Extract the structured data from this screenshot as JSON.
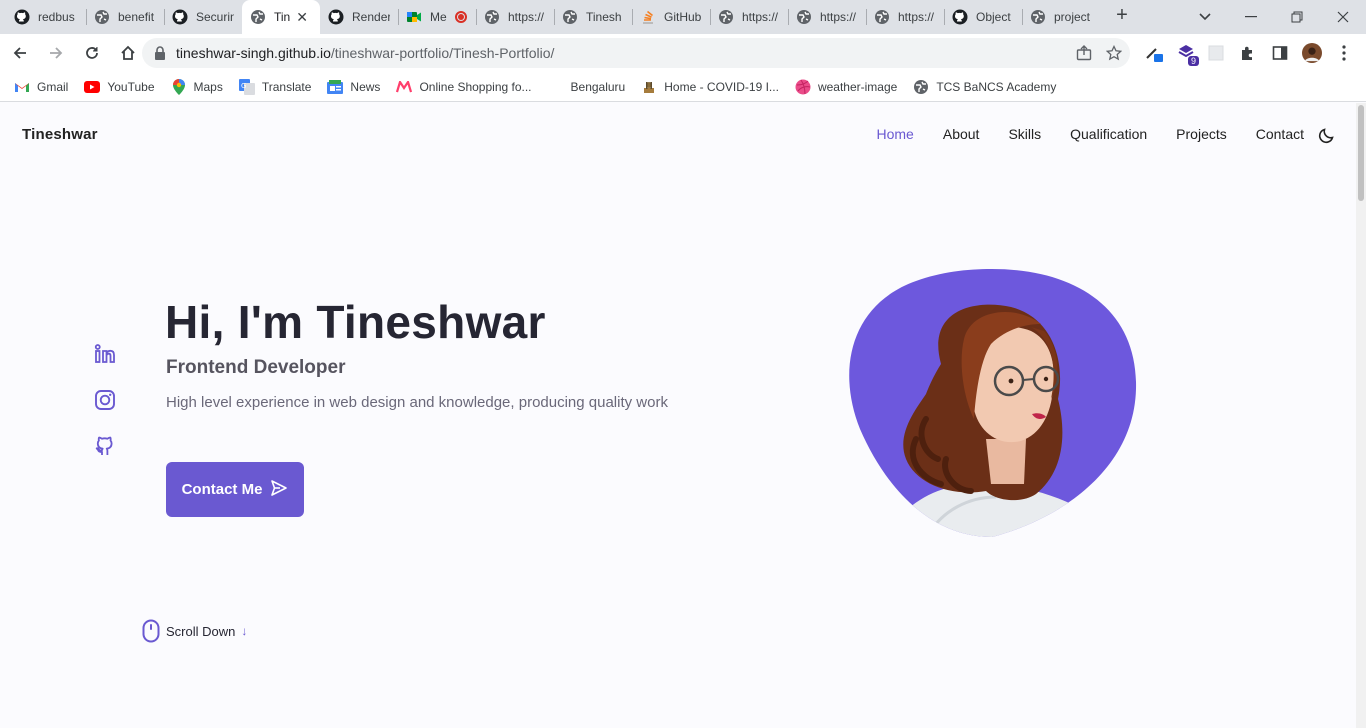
{
  "browser": {
    "tabs": [
      {
        "title": "redbus",
        "icon": "github-icon"
      },
      {
        "title": "benefit",
        "icon": "globe-icon"
      },
      {
        "title": "Securin",
        "icon": "github-icon"
      },
      {
        "title": "Tin",
        "icon": "globe-icon",
        "active": true
      },
      {
        "title": "Render",
        "icon": "github-icon"
      },
      {
        "title": "Me",
        "icon": "meet-icon"
      },
      {
        "title": "https://",
        "icon": "globe-icon"
      },
      {
        "title": "Tinesh",
        "icon": "globe-icon"
      },
      {
        "title": "GitHub",
        "icon": "stack-icon"
      },
      {
        "title": "https://",
        "icon": "globe-icon"
      },
      {
        "title": "https://",
        "icon": "globe-icon"
      },
      {
        "title": "https://",
        "icon": "globe-icon"
      },
      {
        "title": "Object",
        "icon": "github-icon"
      },
      {
        "title": "project",
        "icon": "globe-icon"
      }
    ],
    "url_host": "tineshwar-singh.github.io",
    "url_path": "/tineshwar-portfolio/Tinesh-Portfolio/",
    "extension_badge": "9",
    "bookmarks": [
      {
        "label": "Gmail",
        "icon": "gmail-icon"
      },
      {
        "label": "YouTube",
        "icon": "youtube-icon"
      },
      {
        "label": "Maps",
        "icon": "maps-icon"
      },
      {
        "label": "Translate",
        "icon": "translate-icon"
      },
      {
        "label": "News",
        "icon": "news-icon"
      },
      {
        "label": "Online Shopping fo...",
        "icon": "myntra-icon"
      },
      {
        "label": "Bengaluru",
        "icon": "blank-icon"
      },
      {
        "label": "Home - COVID-19 I...",
        "icon": "emblem-icon"
      },
      {
        "label": "weather-image",
        "icon": "dribbble-icon"
      },
      {
        "label": "TCS BaNCS Academy",
        "icon": "globe-icon"
      }
    ]
  },
  "site": {
    "logo": "Tineshwar",
    "nav": [
      "Home",
      "About",
      "Skills",
      "Qualification",
      "Projects",
      "Contact"
    ],
    "active_nav": "Home",
    "hero": {
      "title": "Hi, I'm Tineshwar",
      "subtitle": "Frontend Developer",
      "description": "High level experience in web design and knowledge, producing quality work",
      "cta_label": "Contact Me"
    },
    "social": [
      "linkedin-icon",
      "instagram-icon",
      "github-icon"
    ],
    "scroll_label": "Scroll Down"
  },
  "colors": {
    "accent": "#6a59d1",
    "title": "#262633",
    "text": "#6a6879",
    "page_bg": "#fbfbfe"
  }
}
